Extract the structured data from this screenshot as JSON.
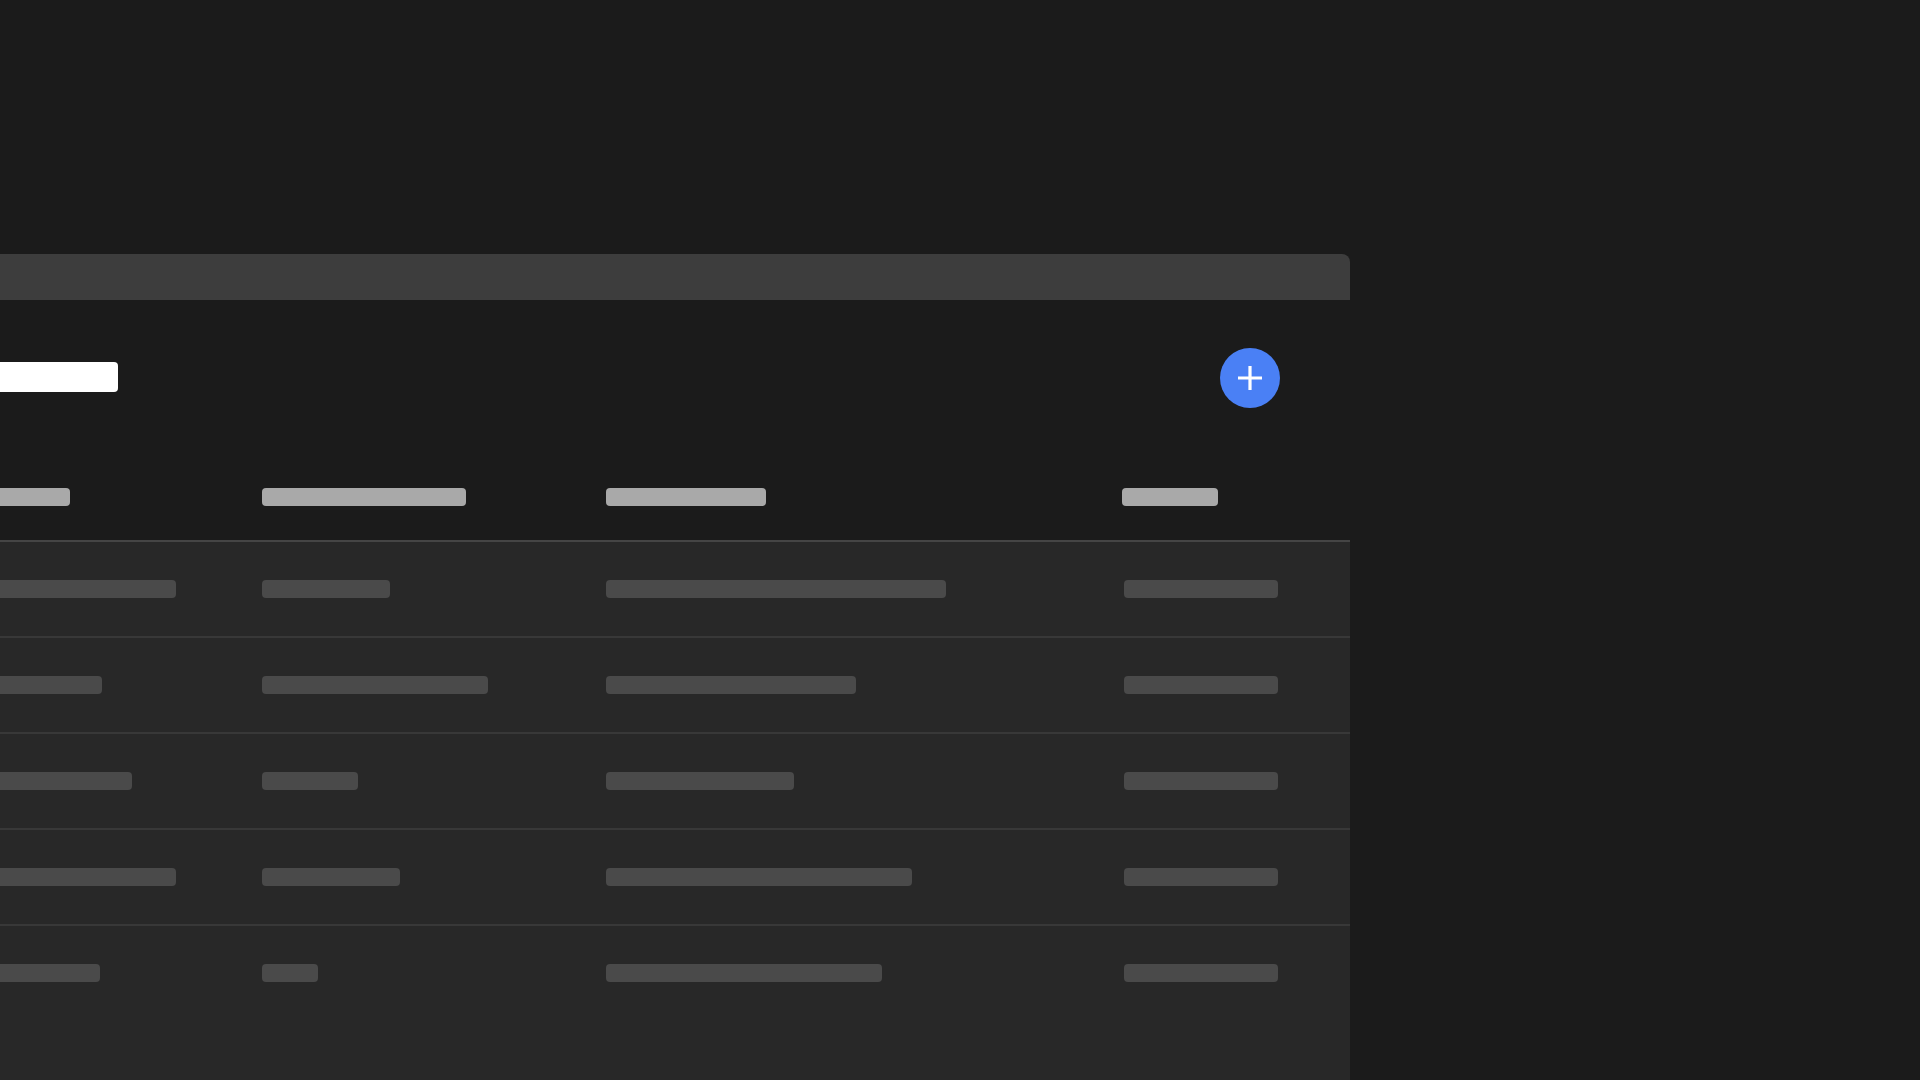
{
  "window": {
    "title": {
      "kind": "skeleton"
    }
  },
  "page": {
    "heading": {
      "kind": "skeleton"
    },
    "add_button": {
      "kind": "plus"
    }
  },
  "table": {
    "columns": [
      {
        "kind": "skeleton"
      },
      {
        "kind": "skeleton"
      },
      {
        "kind": "skeleton"
      },
      {
        "kind": "skeleton"
      }
    ],
    "rows": [
      {
        "cells": [
          {
            "kind": "skeleton"
          },
          {
            "kind": "skeleton"
          },
          {
            "kind": "skeleton"
          },
          {
            "kind": "skeleton"
          }
        ]
      },
      {
        "cells": [
          {
            "kind": "skeleton"
          },
          {
            "kind": "skeleton"
          },
          {
            "kind": "skeleton"
          },
          {
            "kind": "skeleton"
          }
        ]
      },
      {
        "cells": [
          {
            "kind": "skeleton"
          },
          {
            "kind": "skeleton"
          },
          {
            "kind": "skeleton"
          },
          {
            "kind": "skeleton"
          }
        ]
      },
      {
        "cells": [
          {
            "kind": "skeleton"
          },
          {
            "kind": "skeleton"
          },
          {
            "kind": "skeleton"
          },
          {
            "kind": "skeleton"
          }
        ]
      },
      {
        "cells": [
          {
            "kind": "skeleton"
          },
          {
            "kind": "skeleton"
          },
          {
            "kind": "skeleton"
          },
          {
            "kind": "skeleton"
          }
        ]
      }
    ]
  }
}
